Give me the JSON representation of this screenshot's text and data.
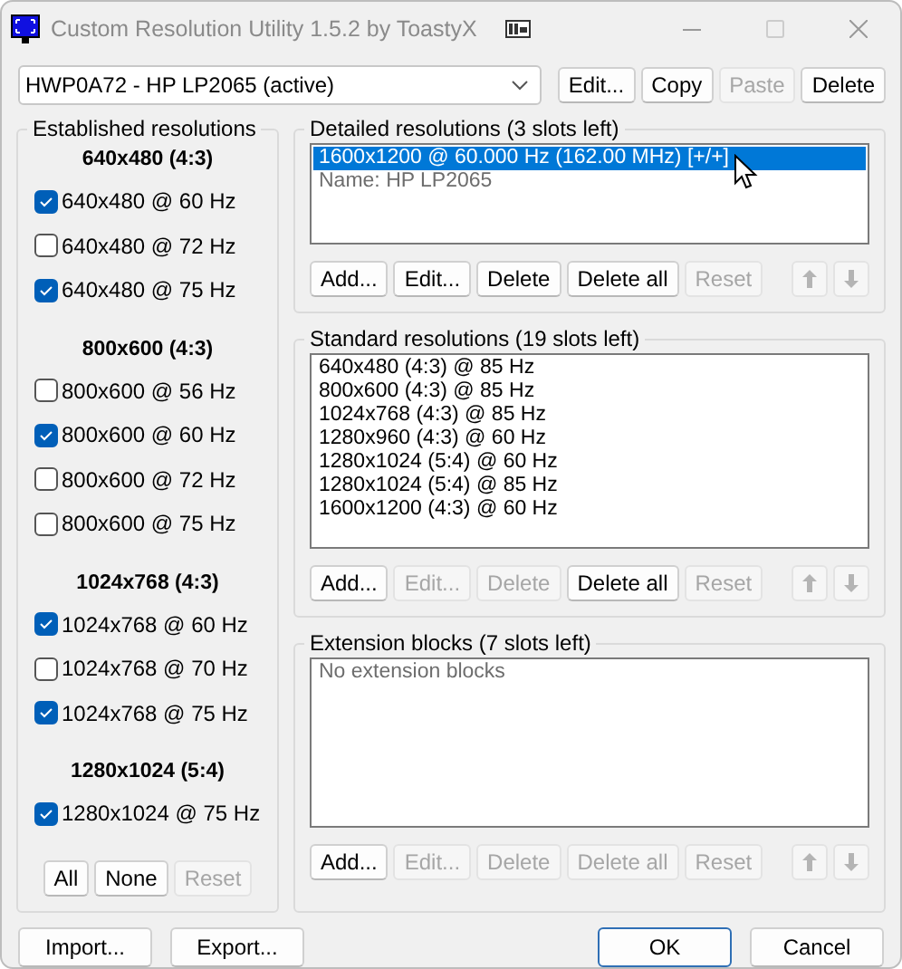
{
  "window": {
    "title": "Custom Resolution Utility 1.5.2 by ToastyX"
  },
  "device": {
    "value": "HWP0A72 - HP LP2065 (active)"
  },
  "device_buttons": [
    {
      "label": "Edit...",
      "disabled": false
    },
    {
      "label": "Copy",
      "disabled": false
    },
    {
      "label": "Paste",
      "disabled": true
    },
    {
      "label": "Delete",
      "disabled": false
    }
  ],
  "established": {
    "title": "Established resolutions",
    "groups": [
      {
        "heading": "640x480 (4:3)",
        "items": [
          {
            "label": "640x480 @ 60 Hz",
            "checked": true
          },
          {
            "label": "640x480 @ 72 Hz",
            "checked": false
          },
          {
            "label": "640x480 @ 75 Hz",
            "checked": true
          }
        ]
      },
      {
        "heading": "800x600 (4:3)",
        "items": [
          {
            "label": "800x600 @ 56 Hz",
            "checked": false
          },
          {
            "label": "800x600 @ 60 Hz",
            "checked": true
          },
          {
            "label": "800x600 @ 72 Hz",
            "checked": false
          },
          {
            "label": "800x600 @ 75 Hz",
            "checked": false
          }
        ]
      },
      {
        "heading": "1024x768 (4:3)",
        "items": [
          {
            "label": "1024x768 @ 60 Hz",
            "checked": true
          },
          {
            "label": "1024x768 @ 70 Hz",
            "checked": false
          },
          {
            "label": "1024x768 @ 75 Hz",
            "checked": true
          }
        ]
      },
      {
        "heading": "1280x1024 (5:4)",
        "items": [
          {
            "label": "1280x1024 @ 75 Hz",
            "checked": true
          }
        ]
      }
    ],
    "buttons": [
      {
        "label": "All",
        "disabled": false
      },
      {
        "label": "None",
        "disabled": false
      },
      {
        "label": "Reset",
        "disabled": true
      }
    ]
  },
  "sections": [
    {
      "title": "Detailed resolutions (3 slots left)",
      "rows": [
        {
          "text": "1600x1200 @ 60.000 Hz (162.00 MHz) [+/+]",
          "kind": "entry",
          "selected": true
        },
        {
          "text": "Name: HP LP2065",
          "kind": "note",
          "selected": false
        }
      ],
      "buttons": [
        {
          "label": "Add...",
          "disabled": false
        },
        {
          "label": "Edit...",
          "disabled": false
        },
        {
          "label": "Delete",
          "disabled": false
        },
        {
          "label": "Delete all",
          "disabled": false
        },
        {
          "label": "Reset",
          "disabled": true
        }
      ],
      "move_up_disabled": true,
      "move_down_disabled": true
    },
    {
      "title": "Standard resolutions (19 slots left)",
      "rows": [
        {
          "text": "640x480 (4:3) @ 85 Hz",
          "kind": "entry",
          "selected": false
        },
        {
          "text": "800x600 (4:3) @ 85 Hz",
          "kind": "entry",
          "selected": false
        },
        {
          "text": "1024x768 (4:3) @ 85 Hz",
          "kind": "entry",
          "selected": false
        },
        {
          "text": "1280x960 (4:3) @ 60 Hz",
          "kind": "entry",
          "selected": false
        },
        {
          "text": "1280x1024 (5:4) @ 60 Hz",
          "kind": "entry",
          "selected": false
        },
        {
          "text": "1280x1024 (5:4) @ 85 Hz",
          "kind": "entry",
          "selected": false
        },
        {
          "text": "1600x1200 (4:3) @ 60 Hz",
          "kind": "entry",
          "selected": false
        }
      ],
      "buttons": [
        {
          "label": "Add...",
          "disabled": false
        },
        {
          "label": "Edit...",
          "disabled": true
        },
        {
          "label": "Delete",
          "disabled": true
        },
        {
          "label": "Delete all",
          "disabled": false
        },
        {
          "label": "Reset",
          "disabled": true
        }
      ],
      "move_up_disabled": true,
      "move_down_disabled": true
    },
    {
      "title": "Extension blocks (7 slots left)",
      "rows": [
        {
          "text": "No extension blocks",
          "kind": "note",
          "selected": false
        }
      ],
      "buttons": [
        {
          "label": "Add...",
          "disabled": false
        },
        {
          "label": "Edit...",
          "disabled": true
        },
        {
          "label": "Delete",
          "disabled": true
        },
        {
          "label": "Delete all",
          "disabled": true
        },
        {
          "label": "Reset",
          "disabled": true
        }
      ],
      "move_up_disabled": true,
      "move_down_disabled": true
    }
  ],
  "footer_left": [
    {
      "label": "Import...",
      "default": false
    },
    {
      "label": "Export...",
      "default": false
    }
  ],
  "footer_right": [
    {
      "label": "OK",
      "default": true
    },
    {
      "label": "Cancel",
      "default": false
    }
  ]
}
